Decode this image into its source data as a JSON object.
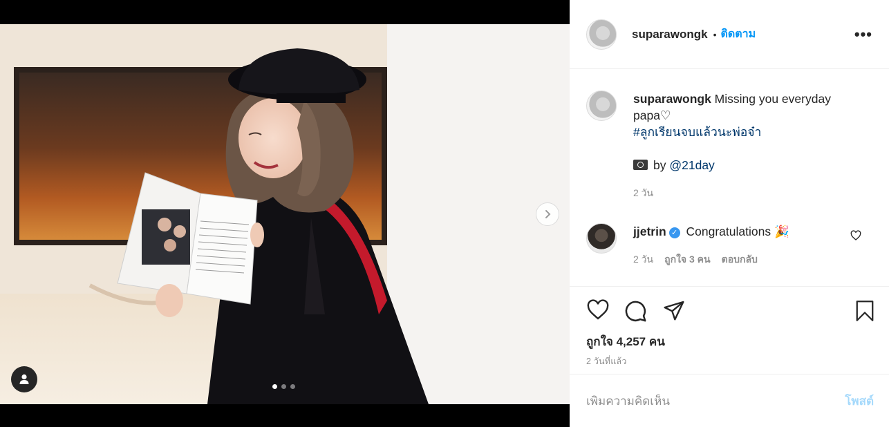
{
  "post": {
    "username": "suparawongk",
    "separator": "•",
    "follow_label": "ติดตาม",
    "more_label": "•••",
    "caption_text": " Missing you everyday papa♡",
    "hashtag": "#ลูกเรียนจบแล้วนะพ่อจ๋า",
    "credit_prefix": "by ",
    "credit_mention": "@21day",
    "caption_time": "2 วัน",
    "comment": {
      "username": "jjetrin",
      "verified_mark": "✓",
      "text": " Congratulations 🎉",
      "time": "2 วัน",
      "likes": "ถูกใจ 3 คน",
      "reply_label": "ตอบกลับ"
    },
    "likes_count": "ถูกใจ 4,257 คน",
    "posted_ago": "2 วันที่แล้ว",
    "comment_placeholder": "เพิ่มความคิดเห็น",
    "post_button": "โพสต์",
    "carousel": {
      "total": 3,
      "current": 1
    }
  }
}
